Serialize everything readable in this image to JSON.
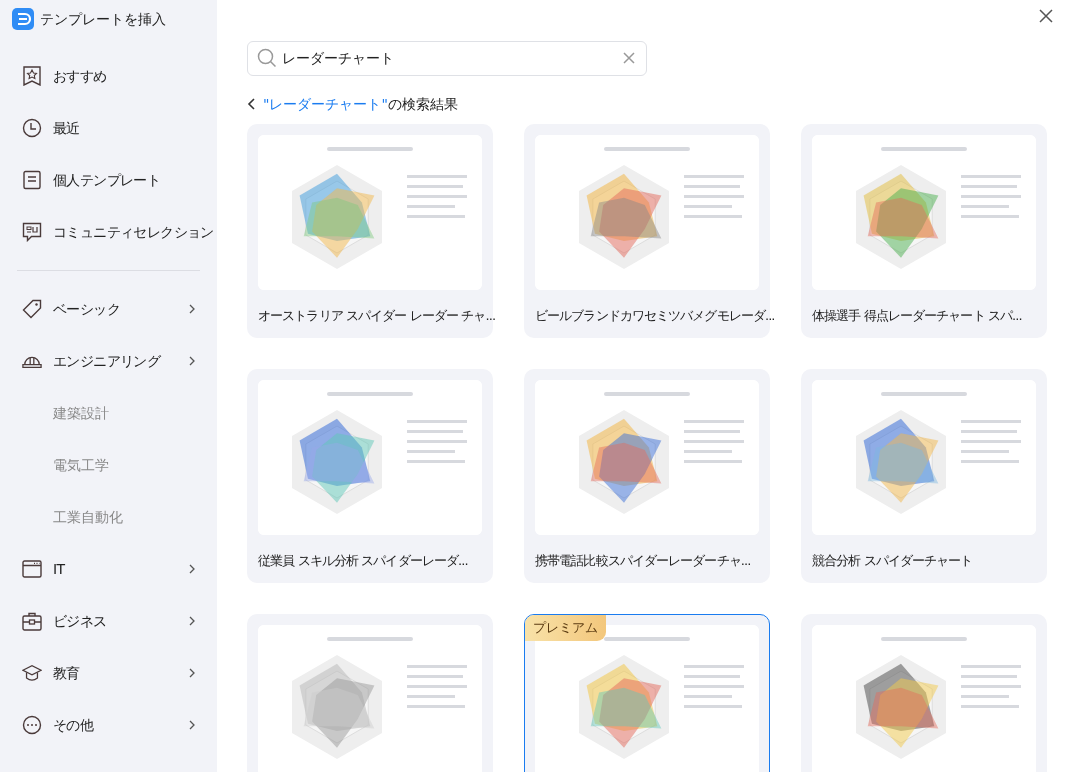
{
  "window": {
    "title": "テンプレートを挿入"
  },
  "sidebar": {
    "top_items": [
      {
        "label": "おすすめ"
      },
      {
        "label": "最近"
      },
      {
        "label": "個人テンプレート"
      },
      {
        "label": "コミュニティセレクション"
      }
    ],
    "category_items": [
      {
        "label": "ベーシック",
        "chevron": true
      },
      {
        "label": "エンジニアリング",
        "chevron": true,
        "children": [
          {
            "label": "建築設計"
          },
          {
            "label": "電気工学"
          },
          {
            "label": "工業自動化"
          }
        ]
      },
      {
        "label": "IT",
        "chevron": true
      },
      {
        "label": "ビジネス",
        "chevron": true
      },
      {
        "label": "教育",
        "chevron": true
      },
      {
        "label": "その他",
        "chevron": true
      }
    ]
  },
  "search": {
    "value": "レーダーチャート"
  },
  "results_header": {
    "query": "\"レーダーチャート\"",
    "suffix": "の検索結果"
  },
  "templates": [
    {
      "title": "オーストラリア スパイダー レーダー チャ...",
      "premium": false,
      "selected": false
    },
    {
      "title": "ビールブランドカワセミツバメグモレーダ...",
      "premium": false,
      "selected": false
    },
    {
      "title": "体操選手 得点レーダーチャート スパ...",
      "premium": false,
      "selected": false
    },
    {
      "title": "従業員 スキル分析 スパイダーレーダ...",
      "premium": false,
      "selected": false
    },
    {
      "title": "携帯電話比較スパイダーレーダーチャ...",
      "premium": false,
      "selected": false
    },
    {
      "title": "競合分析 スパイダーチャート",
      "premium": false,
      "selected": false
    },
    {
      "premium": false,
      "selected": false
    },
    {
      "premium": true,
      "premium_label": "プレミアム",
      "selected": true
    },
    {
      "premium": false,
      "selected": false
    }
  ]
}
